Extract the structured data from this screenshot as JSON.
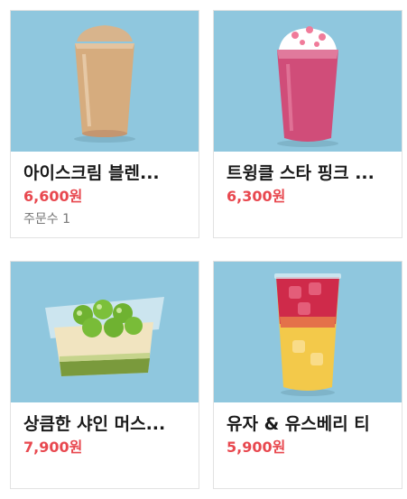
{
  "products": [
    {
      "name": "아이스크림 블렌...",
      "price": "6,600원",
      "order_label": "주문수",
      "order_count": "1",
      "image": "cream-latte-blended-drink"
    },
    {
      "name": "트윙클 스타 핑크 ...",
      "price": "6,300price_placeholder",
      "image": "pink-frappuccino-drink"
    },
    {
      "name": "상큼한 샤인 머스...",
      "price": "7,900원",
      "image": "shine-muscat-mousse-cake"
    },
    {
      "name": "유자 & 유스베리 티",
      "price": "5,900원",
      "image": "yuja-berry-iced-tea"
    }
  ],
  "colors": {
    "thumb_bg": "#8fc7de",
    "price": "#e8484f"
  }
}
